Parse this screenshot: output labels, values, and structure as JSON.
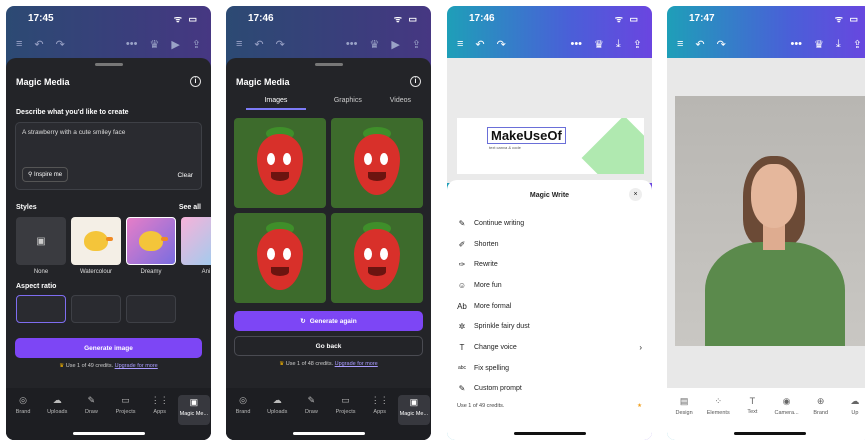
{
  "screen1": {
    "time": "17:45",
    "status_icons": "ᯤ ▭",
    "topbar_icons": [
      "≡",
      "↶",
      "↷",
      "•••",
      "♛",
      "▶",
      "⇪"
    ],
    "sheet_title": "Magic Media",
    "info_icon": "i",
    "describe_label": "Describe what you'd like to create",
    "prompt_text": "A strawberry with a cute smiley face",
    "inspire_label": "⚲ Inspire me",
    "clear_label": "Clear",
    "styles_label": "Styles",
    "see_all_label": "See all",
    "styles": [
      "None",
      "Watercolour",
      "Dreamy",
      "Ani"
    ],
    "aspect_label": "Aspect ratio",
    "generate_label": "Generate image",
    "credits_text": "Use 1 of 49 credits.",
    "upgrade_label": "Upgrade for more",
    "tabs": [
      "Brand",
      "Uploads",
      "Draw",
      "Projects",
      "Apps",
      "Magic Me..."
    ],
    "tab_icons": [
      "◎",
      "☁",
      "✎",
      "▭",
      "⋮⋮",
      "▣"
    ]
  },
  "screen2": {
    "time": "17:46",
    "status_icons": "ᯤ ▭",
    "topbar_icons": [
      "≡",
      "↶",
      "↷",
      "•••",
      "♛",
      "▶",
      "⇪"
    ],
    "sheet_title": "Magic Media",
    "info_icon": "i",
    "segments": [
      "Images",
      "Graphics",
      "Videos"
    ],
    "generate_again_label": "Generate again",
    "refresh_icon": "↻",
    "go_back_label": "Go back",
    "credits_text": "Use 1 of 48 credits.",
    "upgrade_label": "Upgrade for more",
    "tabs": [
      "Brand",
      "Uploads",
      "Draw",
      "Projects",
      "Apps",
      "Magic Me..."
    ],
    "tab_icons": [
      "◎",
      "☁",
      "✎",
      "▭",
      "⋮⋮",
      "▣"
    ]
  },
  "screen3": {
    "time": "17:46",
    "status_icons": "ᯤ ▭",
    "topbar_icons": [
      "≡",
      "↶",
      "↷",
      "•••",
      "♛",
      "⤓",
      "⇪"
    ],
    "design_title": "MakeUseOf",
    "design_subtitle": "text canva & code",
    "sheet_title": "Magic Write",
    "close_icon": "×",
    "items": [
      {
        "icon": "✎",
        "label": "Continue writing"
      },
      {
        "icon": "✐",
        "label": "Shorten"
      },
      {
        "icon": "✑",
        "label": "Rewrite"
      },
      {
        "icon": "☺",
        "label": "More fun"
      },
      {
        "icon": "Ab",
        "label": "More formal"
      },
      {
        "icon": "✲",
        "label": "Sprinkle fairy dust"
      },
      {
        "icon": "T",
        "label": "Change voice"
      },
      {
        "icon": "abc",
        "label": "Fix spelling"
      },
      {
        "icon": "✎",
        "label": "Custom prompt"
      }
    ],
    "chevron": "›",
    "credits_text": "Use 1 of 49 credits.",
    "star": "★"
  },
  "screen4": {
    "time": "17:47",
    "status_icons": "ᯤ ▭",
    "topbar_icons": [
      "≡",
      "↶",
      "↷",
      "•••",
      "♛",
      "⤓",
      "⇪"
    ],
    "tabs": [
      "Design",
      "Elements",
      "Text",
      "Camera...",
      "Brand",
      "Up"
    ],
    "tab_icons": [
      "▤",
      "⁘",
      "T",
      "◉",
      "⊕",
      "☁"
    ]
  }
}
